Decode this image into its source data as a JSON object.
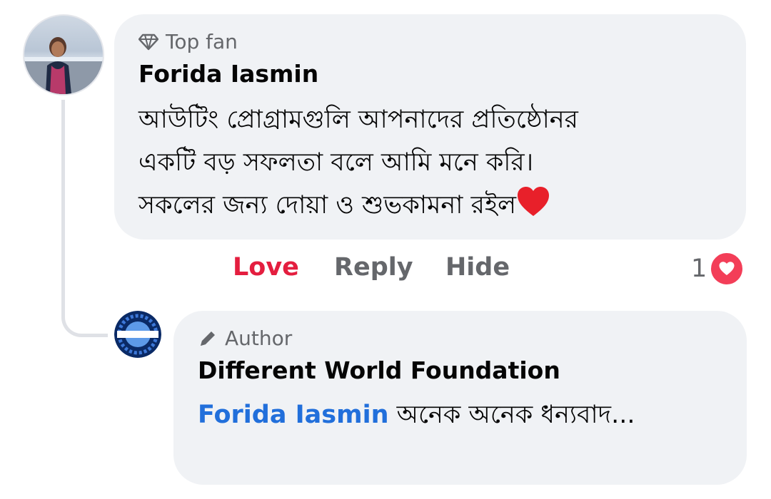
{
  "comment": {
    "badge_label": "Top fan",
    "author": "Forida Iasmin",
    "text_lines": [
      "আউটিং প্রোগ্রামগুলি আপনাদের প্রতিষ্ঠোনর",
      "একটি বড় সফলতা বলে আমি মনে করি।",
      "সকলের জন্য দোয়া  ও শুভকামনা রইল"
    ],
    "emoji": "❤️",
    "actions": {
      "love": "Love",
      "reply": "Reply",
      "hide": "Hide"
    },
    "reaction_count": "1"
  },
  "reply": {
    "badge_label": "Author",
    "author": "Different World Foundation",
    "mention": "Forida Iasmin",
    "text": " অনেক অনেক ধন্যবাদ..."
  },
  "colors": {
    "bubble": "#f0f2f5",
    "love": "#e41e3f",
    "mention": "#216fdb",
    "muted": "#65676b"
  }
}
